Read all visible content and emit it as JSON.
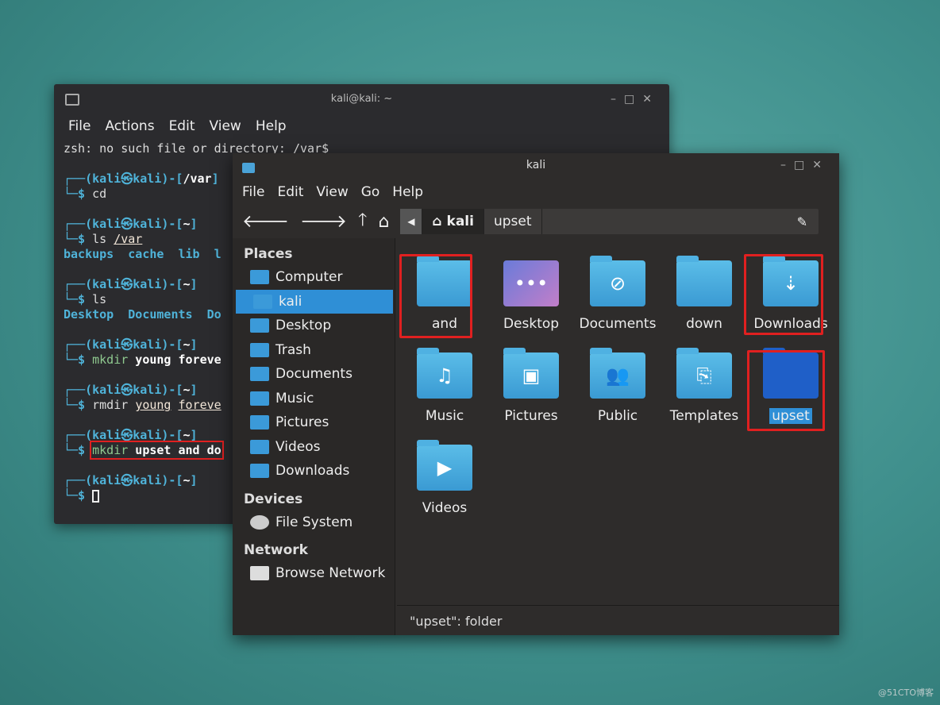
{
  "terminal": {
    "title": "kali@kali: ~",
    "menu": [
      "File",
      "Actions",
      "Edit",
      "View",
      "Help"
    ],
    "lines": {
      "error": "zsh: no such file or directory: /var$",
      "p1": "/var",
      "c1": "cd",
      "p2": "~",
      "c2a": "ls ",
      "c2b": "/var",
      "o2": "backups  cache  lib  l",
      "p3": "~",
      "c3": "ls",
      "o3": "Desktop  Documents  Do",
      "p4": "~",
      "c4a": "mkdir",
      "c4b": " young foreve",
      "p5": "~",
      "c5a": "rmdir ",
      "c5b": "young",
      "c5c": "foreve",
      "p6": "~",
      "c6a": "mkdir",
      "c6b": " upset and do",
      "p7": "~",
      "user": "kali",
      "host": "kali"
    }
  },
  "filemanager": {
    "title": "kali",
    "menu": [
      "File",
      "Edit",
      "View",
      "Go",
      "Help"
    ],
    "path": [
      "kali",
      "upset"
    ],
    "sidebar": {
      "places_label": "Places",
      "places": [
        "Computer",
        "kali",
        "Desktop",
        "Trash",
        "Documents",
        "Music",
        "Pictures",
        "Videos",
        "Downloads"
      ],
      "devices_label": "Devices",
      "devices": [
        "File System"
      ],
      "network_label": "Network",
      "network": [
        "Browse Network"
      ]
    },
    "items": [
      {
        "name": "and",
        "icon": "folder-icon"
      },
      {
        "name": "Desktop",
        "icon": "desktop-folder-icon"
      },
      {
        "name": "Documents",
        "icon": "paperclip-folder-icon"
      },
      {
        "name": "down",
        "icon": "folder-icon"
      },
      {
        "name": "Downloads",
        "icon": "download-folder-icon"
      },
      {
        "name": "Music",
        "icon": "music-folder-icon"
      },
      {
        "name": "Pictures",
        "icon": "image-folder-icon"
      },
      {
        "name": "Public",
        "icon": "people-folder-icon"
      },
      {
        "name": "Templates",
        "icon": "template-folder-icon"
      },
      {
        "name": "upset",
        "icon": "folder-icon",
        "selected": true
      },
      {
        "name": "Videos",
        "icon": "video-folder-icon"
      }
    ],
    "status": "\"upset\": folder"
  },
  "watermark": "@51CTO博客",
  "colors": {
    "highlight": "#e02020",
    "selection": "#2f8fd6",
    "prompt": "#4fb3d9"
  }
}
